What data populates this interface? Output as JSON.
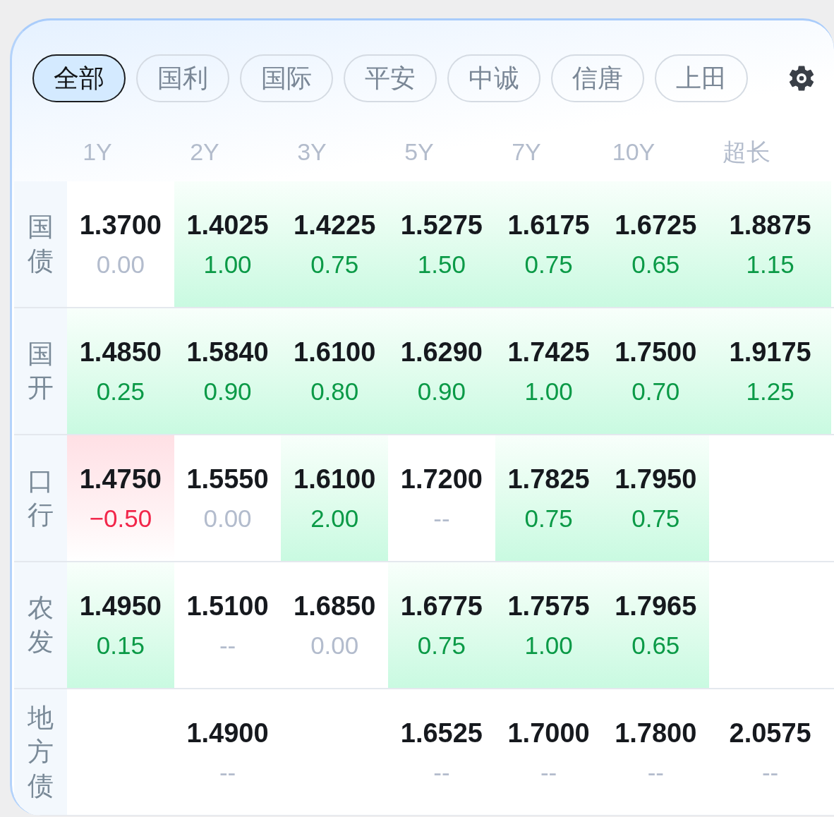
{
  "filters": [
    {
      "label": "全部",
      "selected": true
    },
    {
      "label": "国利",
      "selected": false
    },
    {
      "label": "国际",
      "selected": false
    },
    {
      "label": "平安",
      "selected": false
    },
    {
      "label": "中诚",
      "selected": false
    },
    {
      "label": "信唐",
      "selected": false
    },
    {
      "label": "上田",
      "selected": false
    }
  ],
  "columns": [
    "1Y",
    "2Y",
    "3Y",
    "5Y",
    "7Y",
    "10Y",
    "超长"
  ],
  "rows": [
    {
      "label": "国债",
      "cells": [
        {
          "kind": "flat",
          "value": "1.3700",
          "change": "0.00"
        },
        {
          "kind": "up",
          "value": "1.4025",
          "change": "1.00"
        },
        {
          "kind": "up",
          "value": "1.4225",
          "change": "0.75"
        },
        {
          "kind": "up",
          "value": "1.5275",
          "change": "1.50"
        },
        {
          "kind": "up",
          "value": "1.6175",
          "change": "0.75"
        },
        {
          "kind": "up",
          "value": "1.6725",
          "change": "0.65"
        },
        {
          "kind": "up",
          "value": "1.8875",
          "change": "1.15"
        }
      ]
    },
    {
      "label": "国开",
      "cells": [
        {
          "kind": "up",
          "value": "1.4850",
          "change": "0.25"
        },
        {
          "kind": "up",
          "value": "1.5840",
          "change": "0.90"
        },
        {
          "kind": "up",
          "value": "1.6100",
          "change": "0.80"
        },
        {
          "kind": "up",
          "value": "1.6290",
          "change": "0.90"
        },
        {
          "kind": "up",
          "value": "1.7425",
          "change": "1.00"
        },
        {
          "kind": "up",
          "value": "1.7500",
          "change": "0.70"
        },
        {
          "kind": "up",
          "value": "1.9175",
          "change": "1.25"
        }
      ]
    },
    {
      "label": "口行",
      "cells": [
        {
          "kind": "down",
          "value": "1.4750",
          "change": "−0.50"
        },
        {
          "kind": "flat",
          "value": "1.5550",
          "change": "0.00"
        },
        {
          "kind": "up",
          "value": "1.6100",
          "change": "2.00"
        },
        {
          "kind": "flat",
          "value": "1.7200",
          "change": "--"
        },
        {
          "kind": "up",
          "value": "1.7825",
          "change": "0.75"
        },
        {
          "kind": "up",
          "value": "1.7950",
          "change": "0.75"
        },
        {
          "kind": "empty"
        }
      ]
    },
    {
      "label": "农发",
      "cells": [
        {
          "kind": "up",
          "value": "1.4950",
          "change": "0.15"
        },
        {
          "kind": "flat",
          "value": "1.5100",
          "change": "--"
        },
        {
          "kind": "flat",
          "value": "1.6850",
          "change": "0.00"
        },
        {
          "kind": "up",
          "value": "1.6775",
          "change": "0.75"
        },
        {
          "kind": "up",
          "value": "1.7575",
          "change": "1.00"
        },
        {
          "kind": "up",
          "value": "1.7965",
          "change": "0.65"
        },
        {
          "kind": "empty"
        }
      ]
    },
    {
      "label": "地方债",
      "cells": [
        {
          "kind": "empty"
        },
        {
          "kind": "flat",
          "value": "1.4900",
          "change": "--"
        },
        {
          "kind": "empty"
        },
        {
          "kind": "flat",
          "value": "1.6525",
          "change": "--"
        },
        {
          "kind": "flat",
          "value": "1.7000",
          "change": "--"
        },
        {
          "kind": "flat",
          "value": "1.7800",
          "change": "--"
        },
        {
          "kind": "flat",
          "value": "2.0575",
          "change": "--"
        }
      ]
    }
  ]
}
